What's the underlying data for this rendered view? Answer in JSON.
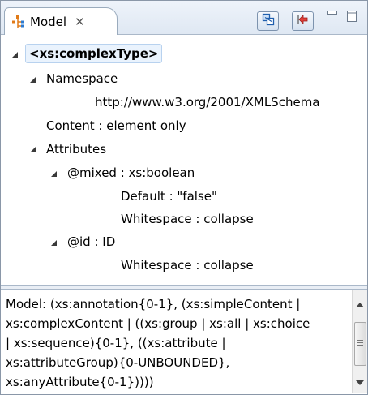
{
  "view": {
    "title": "Model",
    "close_glyph": "✕",
    "icon": "model-tree-icon"
  },
  "toolbar": {
    "buttons": [
      {
        "name": "link-with-editor-button",
        "icon": "link-icon"
      },
      {
        "name": "back-button",
        "icon": "back-arrow-icon"
      }
    ],
    "window_buttons": [
      "minimize",
      "maximize"
    ]
  },
  "tree": {
    "root": "<xs:complexType>",
    "namespace_label": "Namespace",
    "namespace_value": "http://www.w3.org/2001/XMLSchema",
    "content_row": "Content : element only",
    "attributes_label": "Attributes",
    "mixed_row": "@mixed : xs:boolean",
    "mixed_default": "Default : \"false\"",
    "mixed_whitespace": "Whitespace : collapse",
    "id_row": "@id : ID",
    "id_whitespace": "Whitespace : collapse"
  },
  "description": {
    "text": "Model: (xs:annotation{0-1}, (xs:simpleContent |\nxs:complexContent | ((xs:group | xs:all | xs:choice\n| xs:sequence){0-1}, ((xs:attribute |\nxs:attributeGroup){0-UNBOUNDED},\nxs:anyAttribute{0-1}))))"
  },
  "colors": {
    "tab_background": "#ffffff",
    "header_background": "#dfe8f3",
    "selection_background": "#eaf3fd",
    "selection_border": "#b8d2ef"
  }
}
